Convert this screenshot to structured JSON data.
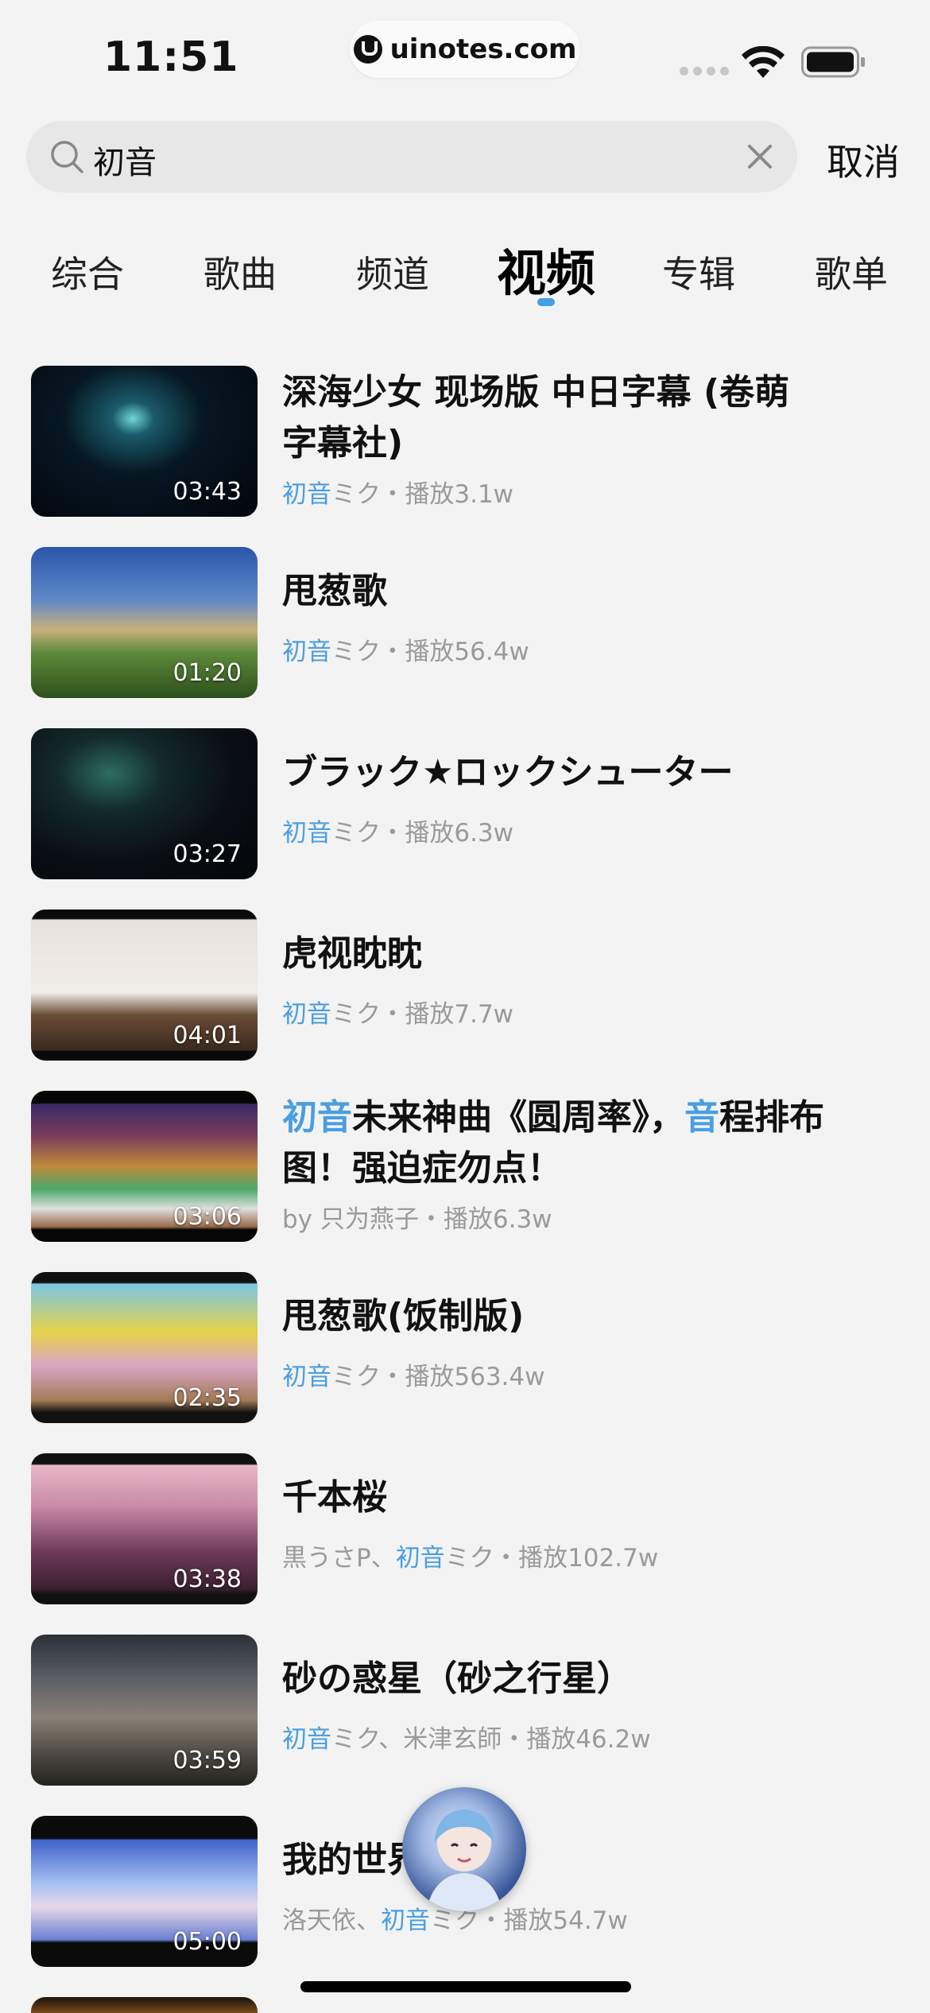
{
  "status_bar": {
    "time": "11:51",
    "url": "uinotes.com"
  },
  "search": {
    "query": "初音",
    "cancel_label": "取消"
  },
  "tabs": [
    {
      "label": "综合"
    },
    {
      "label": "歌曲"
    },
    {
      "label": "频道"
    },
    {
      "label": "视频",
      "active": true
    },
    {
      "label": "专辑"
    },
    {
      "label": "歌单"
    }
  ],
  "results": [
    {
      "title_line1": "深海少女 现场版 中日字幕 (卷萌",
      "title_line2": "字幕社)",
      "duration": "03:43",
      "meta_hl": "初音",
      "meta_rest": "ミク・播放3.1w"
    },
    {
      "title": "甩葱歌",
      "duration": "01:20",
      "meta_hl": "初音",
      "meta_rest": "ミク・播放56.4w"
    },
    {
      "title": "ブラック★ロックシューター",
      "duration": "03:27",
      "meta_hl": "初音",
      "meta_rest": "ミク・播放6.3w"
    },
    {
      "title": "虎视眈眈",
      "duration": "04:01",
      "meta_hl": "初音",
      "meta_rest": "ミク・播放7.7w"
    },
    {
      "title_hl1": "初音",
      "title_mid": "未来神曲《圆周率》，",
      "title_hl2": "音",
      "title_end": "程排布",
      "title_line2": "图！强迫症勿点！",
      "duration": "03:06",
      "meta": "by 只为燕子・播放6.3w"
    },
    {
      "title": "甩葱歌(饭制版)",
      "duration": "02:35",
      "meta_hl": "初音",
      "meta_rest": "ミク・播放563.4w"
    },
    {
      "title": "千本桜",
      "duration": "03:38",
      "meta_pre": "黒うさP、",
      "meta_hl": "初音",
      "meta_rest": "ミク・播放102.7w"
    },
    {
      "title": "砂の惑星（砂之行星）",
      "duration": "03:59",
      "meta_hl": "初音",
      "meta_rest": "ミク、米津玄師・播放46.2w"
    },
    {
      "title": "我的世界",
      "duration": "05:00",
      "meta_pre": "洛天依、",
      "meta_hl": "初音",
      "meta_rest": "ミク・播放54.7w"
    }
  ],
  "colors": {
    "accent": "#4a9ee2",
    "background": "#f3f3f3",
    "meta_gray": "#9a9a9a"
  }
}
